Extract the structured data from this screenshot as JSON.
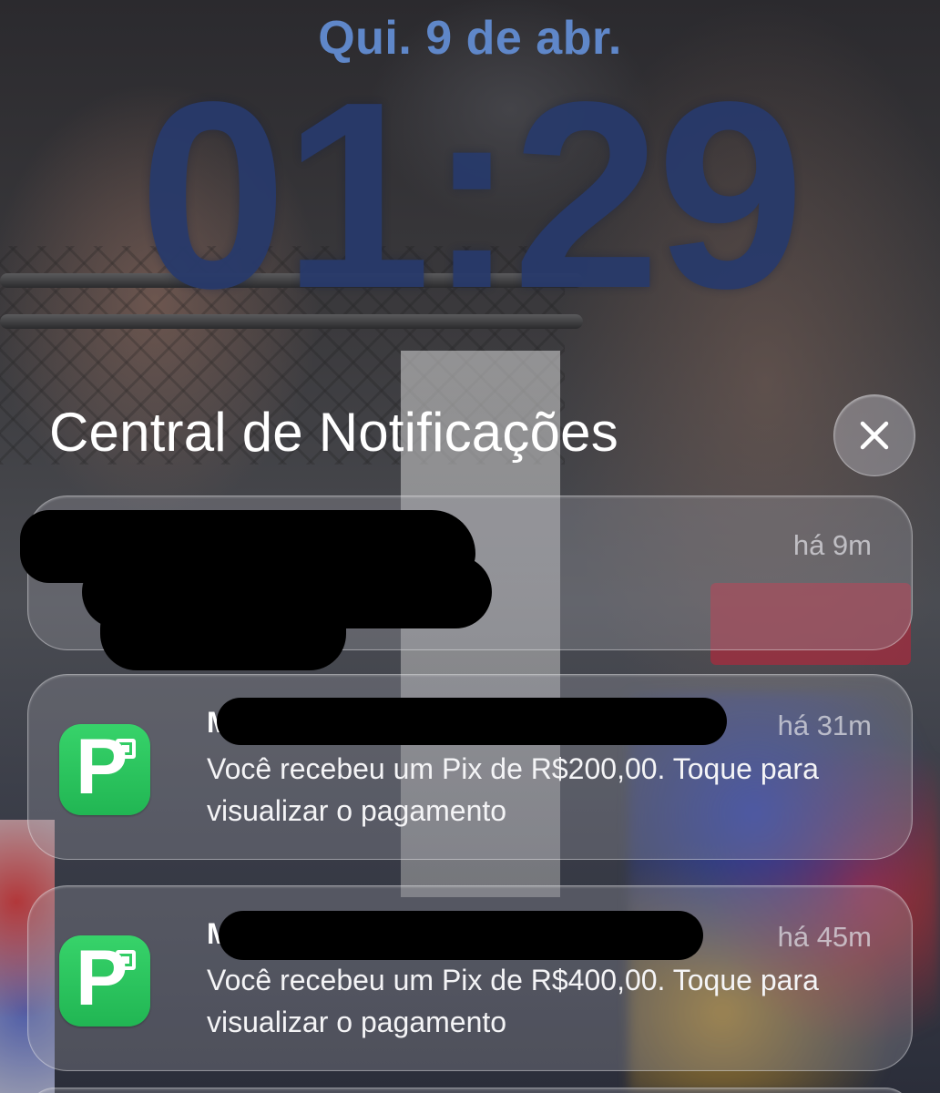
{
  "lockscreen": {
    "date": "Qui. 9 de abr.",
    "time": "01:29"
  },
  "notification_center": {
    "title": "Central de Notificações",
    "close_icon": "close-icon"
  },
  "notifications": [
    {
      "sender": "",
      "time": "há 9m",
      "body": "",
      "app_icon": "redacted"
    },
    {
      "sender": "MU",
      "time": "há 31m",
      "body": "Você recebeu um Pix de R$200,00. Toque para visualizar o pagamento",
      "app_icon": "picpay-icon"
    },
    {
      "sender": "MU",
      "time": "há 45m",
      "body": "Você recebeu um Pix de R$400,00. Toque para visualizar o pagamento",
      "app_icon": "picpay-icon"
    }
  ],
  "colors": {
    "date": "#5f87c9",
    "time": "#283a6b",
    "app_icon_green": "#21b653"
  }
}
